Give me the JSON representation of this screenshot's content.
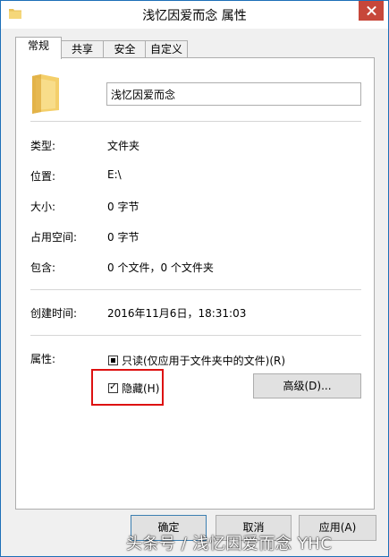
{
  "window": {
    "title": "浅忆因爱而念 属性",
    "icon": "folder-icon",
    "close_icon": "close-icon"
  },
  "tabs": [
    {
      "label": "常规",
      "active": true
    },
    {
      "label": "共享",
      "active": false
    },
    {
      "label": "安全",
      "active": false
    },
    {
      "label": "自定义",
      "active": false
    }
  ],
  "general": {
    "folder_name": "浅忆因爱而念",
    "rows1": [
      {
        "label": "类型:",
        "value": "文件夹"
      },
      {
        "label": "位置:",
        "value": "E:\\"
      },
      {
        "label": "大小:",
        "value": "0 字节"
      },
      {
        "label": "占用空间:",
        "value": "0 字节"
      },
      {
        "label": "包含:",
        "value": "0 个文件，0 个文件夹"
      }
    ],
    "created": {
      "label": "创建时间:",
      "value": "2016年11月6日，18:31:03"
    },
    "attributes_label": "属性:",
    "readonly_label": "只读(仅应用于文件夹中的文件)(R)",
    "hidden_label": "隐藏(H)",
    "hidden_checked": true,
    "advanced_button": "高级(D)..."
  },
  "footer": {
    "ok": "确定",
    "cancel": "取消",
    "apply": "应用(A)"
  },
  "watermark": "头条号 / 浅忆因爱而念 YHC",
  "colors": {
    "accent": "#1d6fb8",
    "close": "#c7473a",
    "highlight": "#dd1111"
  }
}
